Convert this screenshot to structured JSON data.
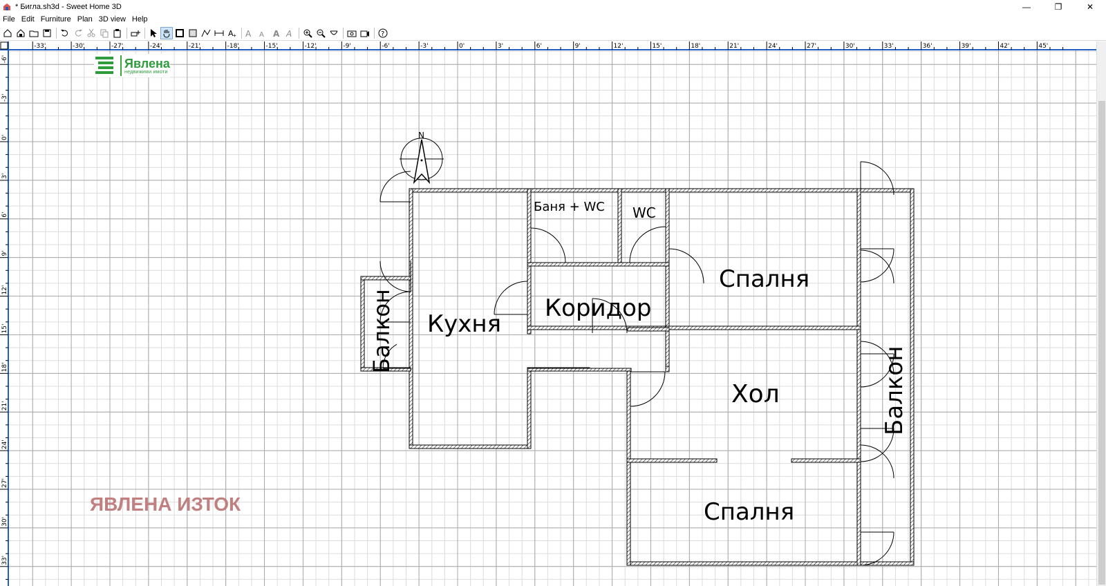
{
  "window": {
    "title": "* Бигла.sh3d - Sweet Home 3D",
    "minimize": "—",
    "maximize": "❐",
    "close": "✕"
  },
  "menu": [
    "File",
    "Edit",
    "Furniture",
    "Plan",
    "3D view",
    "Help"
  ],
  "toolbar_icons": [
    "new-home-icon",
    "new-from-demo-icon",
    "open-icon",
    "save-icon",
    "|",
    "undo-icon",
    "redo-icon",
    "cut-icon",
    "copy-icon",
    "paste-icon",
    "|",
    "add-furniture-icon",
    "|",
    "select-mode-icon",
    "pan-mode-icon",
    "create-walls-icon",
    "create-rooms-icon",
    "create-polylines-icon",
    "create-dimensions-icon",
    "create-labels-icon",
    "|",
    "increase-text-icon",
    "decrease-text-icon",
    "bold-text-icon",
    "italic-text-icon",
    "|",
    "zoom-in-icon",
    "zoom-out-icon",
    "create-photo-icon",
    "|",
    "camera-icon",
    "video-icon",
    "|",
    "help-icon"
  ],
  "ruler": {
    "x_labels": [
      "-33'",
      "-30'",
      "-27'",
      "-24'",
      "-21'",
      "-18'",
      "-15'",
      "-12'",
      "-9'",
      "-6'",
      "-3'",
      "0'",
      "3'",
      "6'",
      "9'",
      "12'",
      "15'",
      "18'",
      "21'",
      "24'",
      "27'",
      "30'",
      "33'",
      "36'",
      "39'",
      "42'",
      "45'"
    ],
    "y_labels": [
      "-6'",
      "-3'",
      "0'",
      "3'",
      "6'",
      "9'",
      "12'",
      "15'",
      "18'",
      "21'",
      "24'",
      "27'",
      "30'",
      "33'"
    ]
  },
  "compass": {
    "label": "N"
  },
  "rooms": {
    "kitchen": "Кухня",
    "bath": "Баня + WC",
    "wc": "WC",
    "corridor": "Коридор",
    "bedroom1": "Спалня",
    "living": "Хол",
    "bedroom2": "Спалня",
    "balcony_left": "Балкон",
    "balcony_right": "Балкон"
  },
  "logo": {
    "name": "Явлена",
    "subtitle": "недвижими имоти"
  },
  "watermark": "ЯВЛЕНА ИЗТОК",
  "colors": {
    "grid_minor": "#dcdcdc",
    "grid_major": "#a8a8a8",
    "wall": "#000000",
    "logo": "#2e9c3a",
    "watermark": "#c08080",
    "ruler_accent": "#1e5fbf"
  }
}
